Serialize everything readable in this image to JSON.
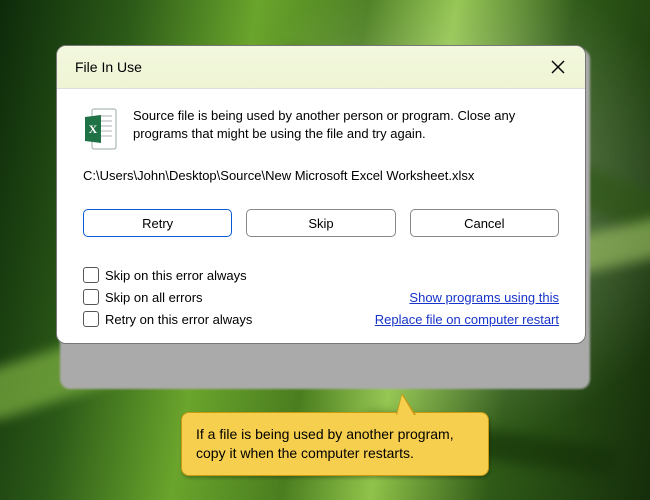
{
  "dialog": {
    "title": "File In Use",
    "message": "Source file is being used by another person or program. Close any programs that might be using the file and try again.",
    "path": "C:\\Users\\John\\Desktop\\Source\\New Microsoft Excel Worksheet.xlsx",
    "buttons": {
      "retry": "Retry",
      "skip": "Skip",
      "cancel": "Cancel"
    },
    "checks": {
      "skip_this": "Skip on this error always",
      "skip_all": "Skip on all errors",
      "retry_this": "Retry on this error always"
    },
    "links": {
      "show_programs": "Show programs using this",
      "replace_restart": "Replace file on computer restart"
    }
  },
  "callout": {
    "text": "If a file is being used by another program, copy it when the computer restarts."
  },
  "icons": {
    "excel": "excel-file-icon",
    "close": "close-icon"
  },
  "colors": {
    "link": "#1733c9",
    "primary_border": "#0a5bd3",
    "callout_bg": "#f7cf4f"
  }
}
